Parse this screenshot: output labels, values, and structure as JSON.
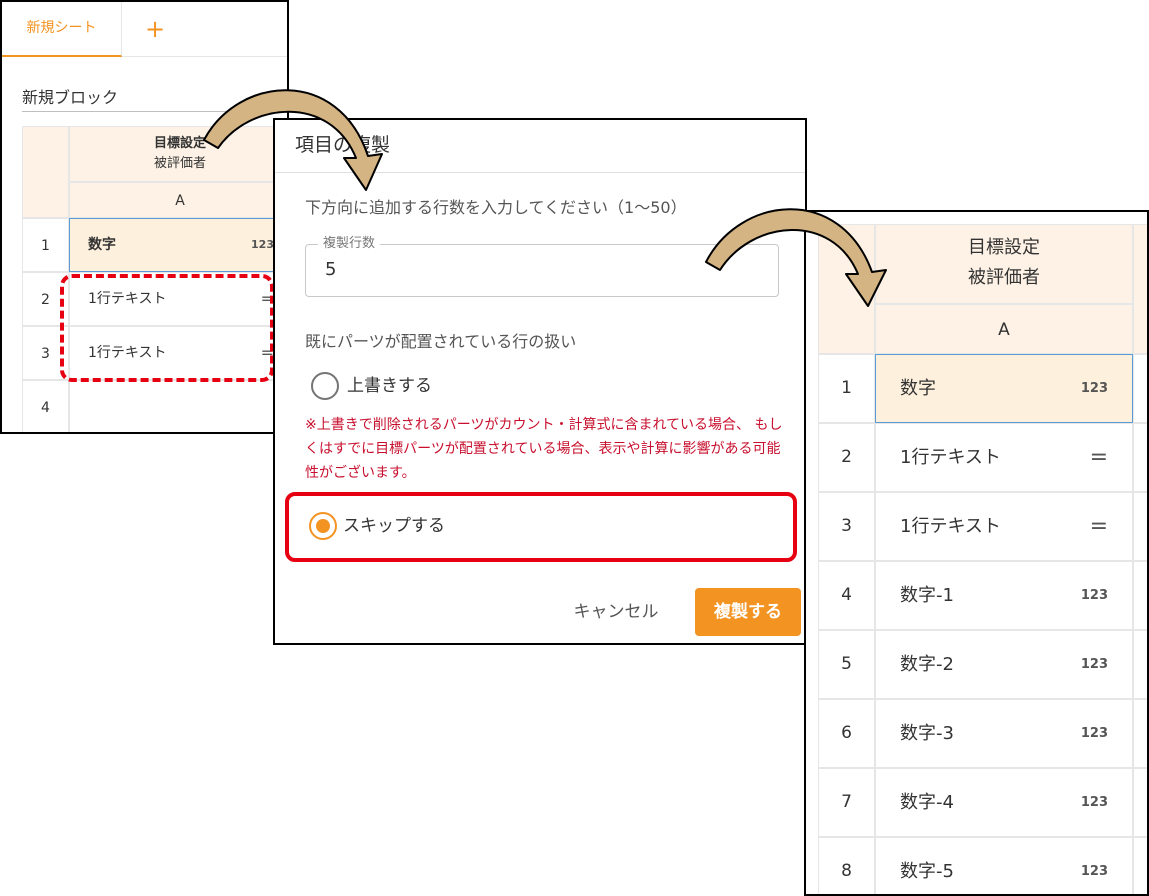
{
  "colors": {
    "accent": "#f39322",
    "warning": "#c8102e",
    "highlight": "#e60012",
    "header_bg": "#fdf2e5",
    "selected_bg": "#fdf0dc"
  },
  "panel1": {
    "tab_active": "新規シート",
    "tab_add": "+",
    "block_name": "新規ブロック",
    "header_title": "目標設定",
    "header_sub": "被評価者",
    "column": "A",
    "rows": [
      {
        "num": "1",
        "label": "数字",
        "icon": "123"
      },
      {
        "num": "2",
        "label": "1行テキスト",
        "icon": "="
      },
      {
        "num": "3",
        "label": "1行テキスト",
        "icon": "="
      },
      {
        "num": "4",
        "label": "",
        "icon": ""
      }
    ]
  },
  "dialog": {
    "title": "項目の複製",
    "instruction": "下方向に追加する行数を入力してください（1〜50）",
    "field_label": "複製行数",
    "field_value": "5",
    "section_label": "既にパーツが配置されている行の扱い",
    "option_overwrite": "上書きする",
    "warning": "※上書きで削除されるパーツがカウント・計算式に含まれている場合、 もしくはすでに目標パーツが配置されている場合、表示や計算に影響がある可能性がございます。",
    "option_skip": "スキップする",
    "cancel": "キャンセル",
    "submit": "複製する"
  },
  "panel3": {
    "header_title": "目標設定",
    "header_sub": "被評価者",
    "column": "A",
    "rows": [
      {
        "num": "1",
        "label": "数字",
        "icon": "123"
      },
      {
        "num": "2",
        "label": "1行テキスト",
        "icon": "="
      },
      {
        "num": "3",
        "label": "1行テキスト",
        "icon": "="
      },
      {
        "num": "4",
        "label": "数字-1",
        "icon": "123"
      },
      {
        "num": "5",
        "label": "数字-2",
        "icon": "123"
      },
      {
        "num": "6",
        "label": "数字-3",
        "icon": "123"
      },
      {
        "num": "7",
        "label": "数字-4",
        "icon": "123"
      },
      {
        "num": "8",
        "label": "数字-5",
        "icon": "123"
      }
    ]
  }
}
